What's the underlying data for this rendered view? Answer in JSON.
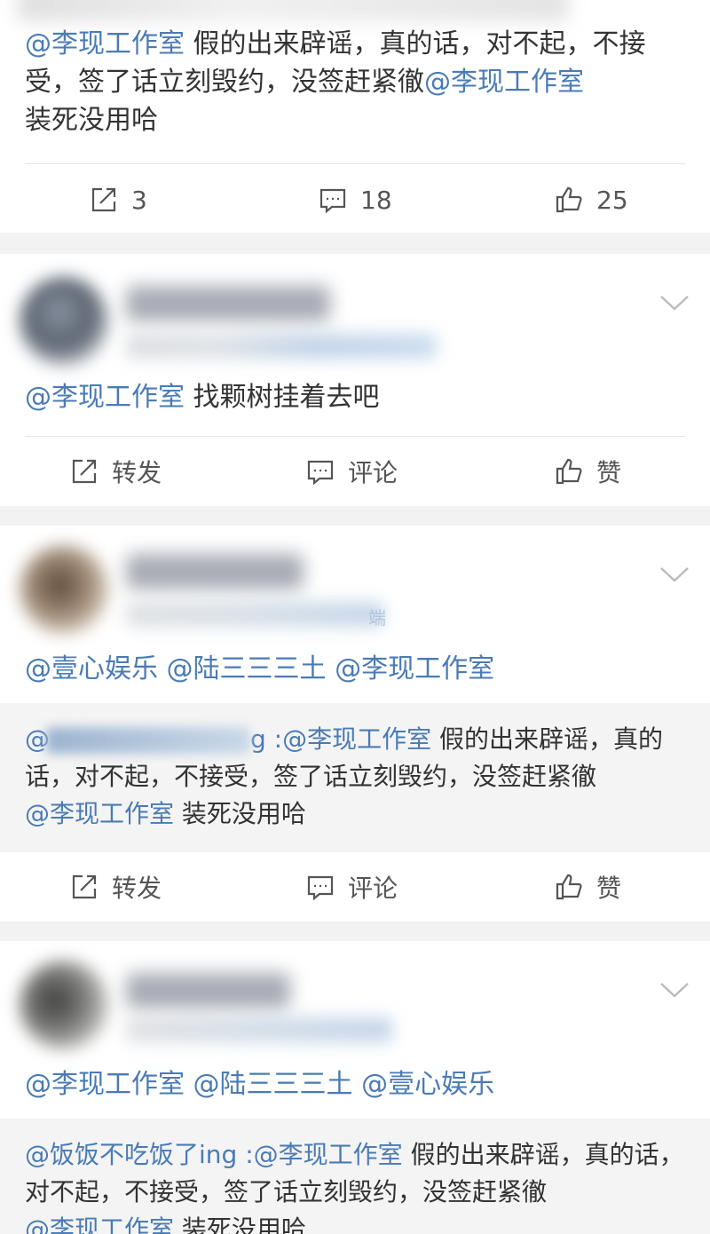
{
  "post1": {
    "mention": "@李现工作室",
    "text_a": " 假的出来辟谣，真的话，对不起，不接受，签了话立刻毁约，没签赶紧徹",
    "mention_b": "@李现工作室",
    "text_b": "装死没用哈",
    "repost_count": "3",
    "comment_count": "18",
    "like_count": "25"
  },
  "post2": {
    "mention": "@李现工作室",
    "text": " 找颗树挂着去吧",
    "repost_label": "转发",
    "comment_label": "评论",
    "like_label": "赞"
  },
  "post3": {
    "mentions": "@壹心娱乐 @陆三三三土 @李现工作室",
    "quote_prefix": "@",
    "quote_suffix": "g :",
    "quote_mention": "@李现工作室",
    "quote_text_a": " 假的出来辟谣，真的话，对不起，不接受，签了话立刻毁约，没签赶紧徹",
    "quote_mention_b": "@李现工作室",
    "quote_text_b": " 装死没用哈",
    "repost_label": "转发",
    "comment_label": "评论",
    "like_label": "赞",
    "meta_suffix": "端"
  },
  "post4": {
    "mentions": "@李现工作室 @陆三三三土 @壹心娱乐",
    "quote_user": "@饭饭不吃饭了ing",
    "quote_colon": " :",
    "quote_mention": "@李现工作室",
    "quote_text_a": " 假的出来辟谣，真的话，对不起，不接受，签了话立刻毁约，没签赶紧徹",
    "quote_mention_b": "@李现工作室",
    "quote_text_b": " 装死没用哈"
  },
  "colors": {
    "mention": "#4a7bb5",
    "text": "#333333",
    "action": "#555555",
    "bg": "#f2f2f2"
  },
  "icons": [
    "repost-icon",
    "comment-icon",
    "like-icon",
    "chevron-down-icon"
  ]
}
